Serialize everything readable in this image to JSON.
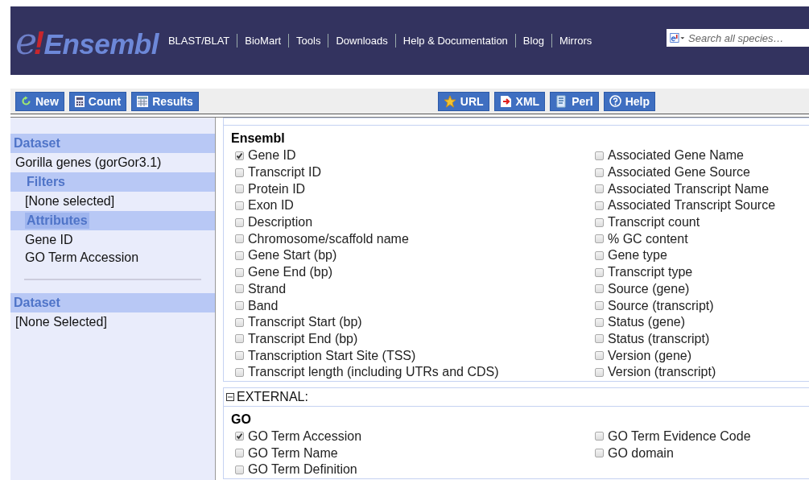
{
  "header": {
    "logo": {
      "prefix": "e",
      "mark": "!",
      "name": "Ensembl"
    },
    "nav": [
      "BLAST/BLAT",
      "BioMart",
      "Tools",
      "Downloads",
      "Help & Documentation",
      "Blog",
      "Mirrors"
    ],
    "search": {
      "placeholder": "Search all species…"
    }
  },
  "toolbar": {
    "left": [
      {
        "label": "New"
      },
      {
        "label": "Count"
      },
      {
        "label": "Results"
      }
    ],
    "right": [
      {
        "label": "URL"
      },
      {
        "label": "XML"
      },
      {
        "label": "Perl"
      },
      {
        "label": "Help"
      }
    ]
  },
  "sidebar": {
    "sections": [
      {
        "title": "Dataset",
        "value": "Gorilla genes (gorGor3.1)",
        "children": [
          {
            "title": "Filters",
            "selected": false,
            "values": [
              "[None selected]"
            ]
          },
          {
            "title": "Attributes",
            "selected": true,
            "values": [
              "Gene ID",
              "GO Term Accession"
            ]
          }
        ]
      },
      {
        "title": "Dataset",
        "value": "[None Selected]"
      }
    ]
  },
  "sections": [
    {
      "groups": [
        {
          "name": "Ensembl",
          "items": [
            {
              "label": "Gene ID",
              "checked": true
            },
            {
              "label": "Transcript ID",
              "checked": false
            },
            {
              "label": "Protein ID",
              "checked": false
            },
            {
              "label": "Exon ID",
              "checked": false
            },
            {
              "label": "Description",
              "checked": false
            },
            {
              "label": "Chromosome/scaffold name",
              "checked": false
            },
            {
              "label": "Gene Start (bp)",
              "checked": false
            },
            {
              "label": "Gene End (bp)",
              "checked": false
            },
            {
              "label": "Strand",
              "checked": false
            },
            {
              "label": "Band",
              "checked": false
            },
            {
              "label": "Transcript Start (bp)",
              "checked": false
            },
            {
              "label": "Transcript End (bp)",
              "checked": false
            },
            {
              "label": "Transcription Start Site (TSS)",
              "checked": false
            },
            {
              "label": "Transcript length (including UTRs and CDS)",
              "checked": false
            },
            {
              "label": "Associated Gene Name",
              "checked": false
            },
            {
              "label": "Associated Gene Source",
              "checked": false
            },
            {
              "label": "Associated Transcript Name",
              "checked": false
            },
            {
              "label": "Associated Transcript Source",
              "checked": false
            },
            {
              "label": "Transcript count",
              "checked": false
            },
            {
              "label": "% GC content",
              "checked": false
            },
            {
              "label": "Gene type",
              "checked": false
            },
            {
              "label": "Transcript type",
              "checked": false
            },
            {
              "label": "Source (gene)",
              "checked": false
            },
            {
              "label": "Source (transcript)",
              "checked": false
            },
            {
              "label": "Status (gene)",
              "checked": false
            },
            {
              "label": "Status (transcript)",
              "checked": false
            },
            {
              "label": "Version (gene)",
              "checked": false
            },
            {
              "label": "Version (transcript)",
              "checked": false
            }
          ]
        }
      ]
    },
    {
      "title": "EXTERNAL:",
      "groups": [
        {
          "name": "GO",
          "items": [
            {
              "label": "GO Term Accession",
              "checked": true
            },
            {
              "label": "GO Term Name",
              "checked": false
            },
            {
              "label": "GO Term Definition",
              "checked": false
            },
            {
              "label": "GO Term Evidence Code",
              "checked": false
            },
            {
              "label": "GO domain",
              "checked": false
            }
          ]
        }
      ]
    }
  ]
}
